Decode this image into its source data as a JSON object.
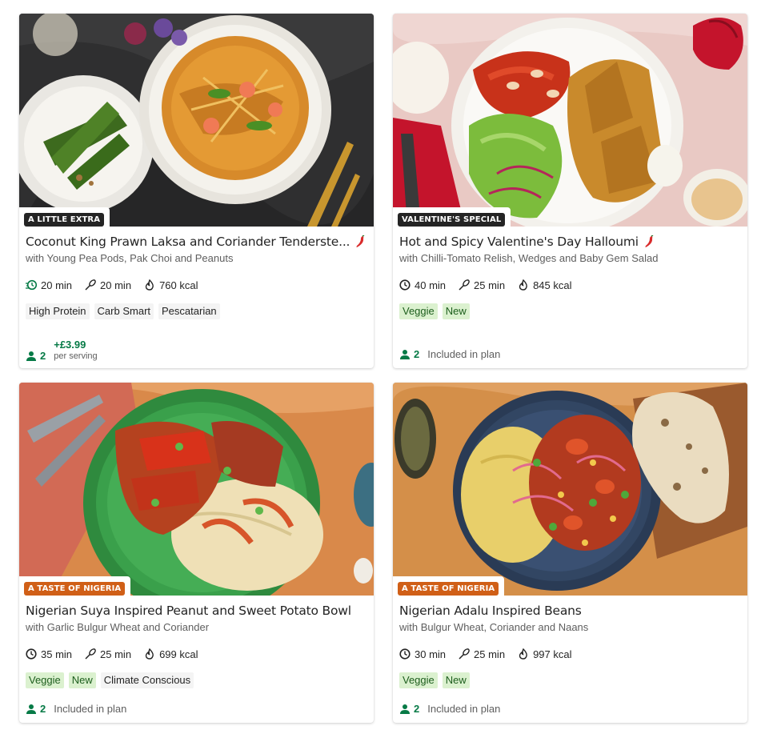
{
  "colors": {
    "tag_dark": "#242424",
    "tag_orange": "#d05f17",
    "green_text": "#067a46",
    "chip_green_bg": "#dbf1cf",
    "chip_grey_bg": "#f4f4f4"
  },
  "icons": {
    "quick_time": "quick-clock-icon",
    "time": "clock-icon",
    "prep": "whisk-icon",
    "calories": "flame-icon",
    "spicy": "chili-icon",
    "servings": "person-icon"
  },
  "recipes": [
    {
      "tag": "A LITTLE EXTRA",
      "title": "Coconut King Prawn Laksa and Coriander Tenderste...",
      "spicy": true,
      "subtitle": "with Young Pea Pods, Pak Choi and Peanuts",
      "total_time": "20 min",
      "prep_time": "20 min",
      "calories": "760 kcal",
      "chips": [
        "High Protein",
        "Carb Smart",
        "Pescatarian"
      ],
      "servings": "2",
      "price": "+£3.99",
      "price_note": "per serving"
    },
    {
      "tag": "VALENTINE'S SPECIAL",
      "title": "Hot and Spicy Valentine's Day Halloumi",
      "spicy": true,
      "subtitle": "with Chilli-Tomato Relish, Wedges and Baby Gem Salad",
      "total_time": "40 min",
      "prep_time": "25 min",
      "calories": "845 kcal",
      "chips": [
        "Veggie",
        "New"
      ],
      "servings": "2",
      "plan_note": "Included in plan"
    },
    {
      "tag": "A TASTE OF NIGERIA",
      "title": "Nigerian Suya Inspired Peanut and Sweet Potato Bowl",
      "spicy": false,
      "subtitle": "with Garlic Bulgur Wheat and Coriander",
      "total_time": "35 min",
      "prep_time": "25 min",
      "calories": "699 kcal",
      "chips": [
        "Veggie",
        "New",
        "Climate Conscious"
      ],
      "servings": "2",
      "plan_note": "Included in plan"
    },
    {
      "tag": "A TASTE OF NIGERIA",
      "title": "Nigerian Adalu Inspired Beans",
      "spicy": false,
      "subtitle": "with Bulgur Wheat, Coriander and Naans",
      "total_time": "30 min",
      "prep_time": "25 min",
      "calories": "997 kcal",
      "chips": [
        "Veggie",
        "New"
      ],
      "servings": "2",
      "plan_note": "Included in plan"
    }
  ]
}
